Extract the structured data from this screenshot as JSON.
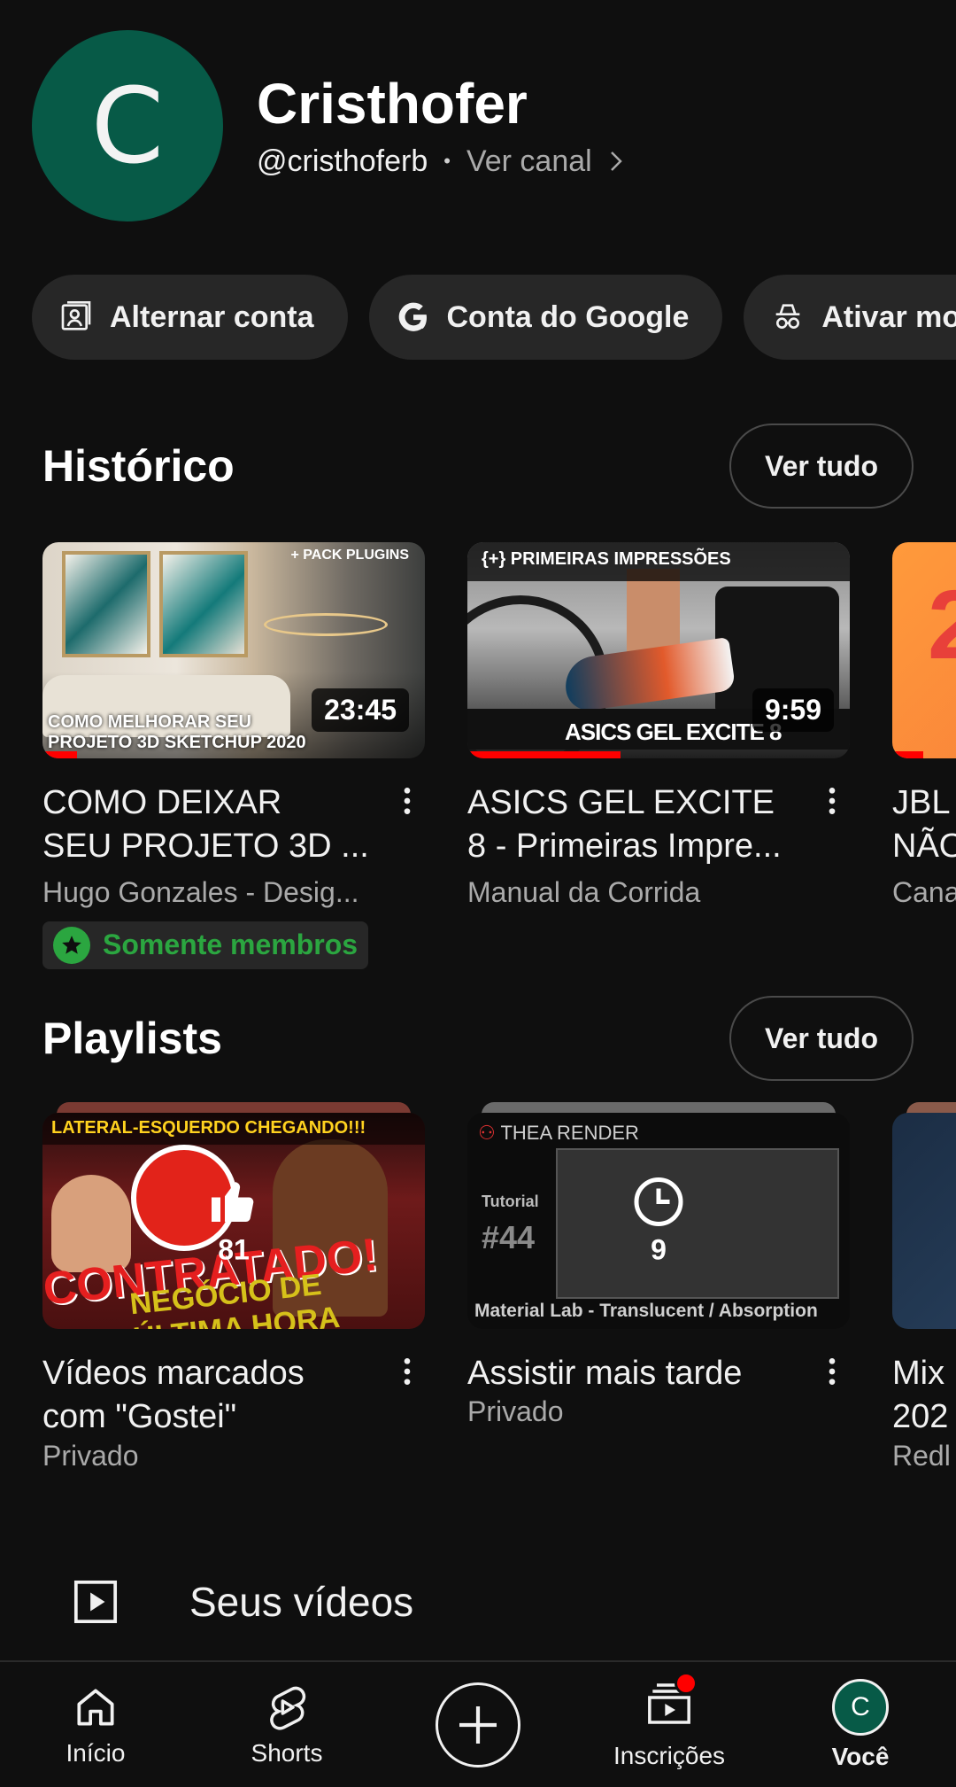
{
  "profile": {
    "avatar_letter": "C",
    "name": "Cristhofer",
    "handle": "@cristhoferb",
    "separator": "•",
    "view_channel": "Ver canal"
  },
  "chips": [
    {
      "label": "Alternar conta",
      "icon": "switch-account-icon"
    },
    {
      "label": "Conta do Google",
      "icon": "google-icon"
    },
    {
      "label": "Ativar mod",
      "icon": "incognito-icon"
    }
  ],
  "history": {
    "title": "Histórico",
    "see_all": "Ver tudo",
    "items": [
      {
        "thumb_caption_l1": "COMO MELHORAR SEU",
        "thumb_caption_l2": "PROJETO 3D SKETCHUP 2020",
        "thumb_tag": "+ PACK PLUGINS",
        "duration": "23:45",
        "progress": 0.09,
        "title_l1": "COMO DEIXAR",
        "title_l2": "SEU PROJETO 3D ...",
        "channel": "Hugo Gonzales - Desig...",
        "badge": "Somente membros"
      },
      {
        "thumb_top": "{+} PRIMEIRAS IMPRESSÕES",
        "thumb_bottom": "ASICS GEL EXCITE 8",
        "duration": "9:59",
        "progress": 0.4,
        "title_l1": "ASICS GEL EXCITE",
        "title_l2": "8 - Primeiras Impre...",
        "channel": "Manual da Corrida"
      },
      {
        "thumb_text": "2",
        "title_l1": "JBL",
        "title_l2": "NÃO",
        "channel": "Cana"
      }
    ]
  },
  "playlists": {
    "title": "Playlists",
    "see_all": "Ver tudo",
    "items": [
      {
        "thumb_banner": "LATERAL-ESQUERDO CHEGANDO!!!",
        "thumb_big1": "CONTRATADO!",
        "thumb_big2": "NEGÓCIO DE ÚLTIMA HORA",
        "count": "81",
        "icon": "thumbs-up-icon",
        "title_l1": "Vídeos marcados",
        "title_l2": "com \"Gostei\"",
        "privacy": "Privado"
      },
      {
        "thumb_brand": "THEA RENDER",
        "thumb_tut": "Tutorial",
        "thumb_num": "#44",
        "thumb_footer": "Material Lab - Translucent / Absorption",
        "count": "9",
        "icon": "clock-icon",
        "title_l1": "Assistir mais tarde",
        "privacy": "Privado"
      },
      {
        "title_l1": "Mix",
        "title_l2": "202",
        "privacy": "Redl"
      }
    ]
  },
  "your_videos": {
    "label": "Seus vídeos",
    "icon": "play-square-icon"
  },
  "bottom_nav": [
    {
      "label": "Início",
      "icon": "home-icon"
    },
    {
      "label": "Shorts",
      "icon": "shorts-icon"
    },
    {
      "label": "",
      "icon": "create-plus-icon"
    },
    {
      "label": "Inscrições",
      "icon": "subscriptions-icon",
      "has_badge": true
    },
    {
      "label": "Você",
      "icon": "avatar",
      "avatar_letter": "C"
    }
  ],
  "colors": {
    "background": "#0f0f0f",
    "chip": "#272727",
    "avatar": "#075a47",
    "members_green": "#2ba640",
    "progress_red": "#ff0000"
  }
}
